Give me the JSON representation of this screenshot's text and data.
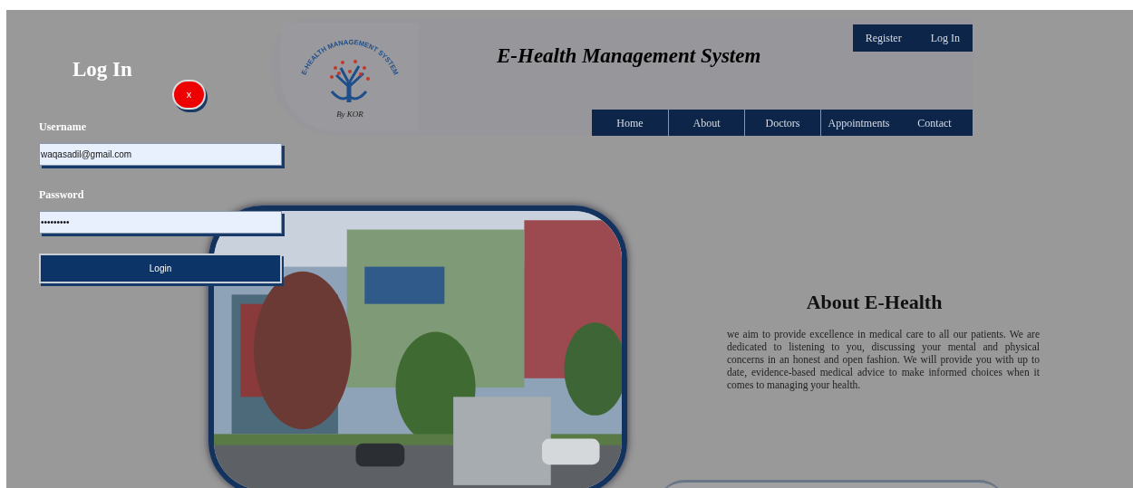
{
  "login_panel": {
    "title": "Log In",
    "close_label": "x",
    "fields": [
      {
        "label": "Username",
        "value": "waqasadil@gmail.com"
      },
      {
        "label": "Password",
        "value": "•••••••••"
      }
    ],
    "submit": "Login"
  },
  "header": {
    "logo_text": "E-HEALTH MANAGEMENT SYSTEM",
    "logo_caption": "By KOR",
    "title": "E-Health Management System",
    "account_links": [
      "Register",
      "Log In"
    ],
    "nav": [
      "Home",
      "About",
      "Doctors",
      "Appointments",
      "Contact"
    ]
  },
  "about": {
    "heading": "About E-Health",
    "body": "we aim to provide excellence in medical care to all our patients. We are dedicated to listening to you, discussing your mental and physical concerns in an honest and open fashion. We will provide you with up to date, evidence-based medical advice to make informed choices when it comes to managing your health."
  }
}
